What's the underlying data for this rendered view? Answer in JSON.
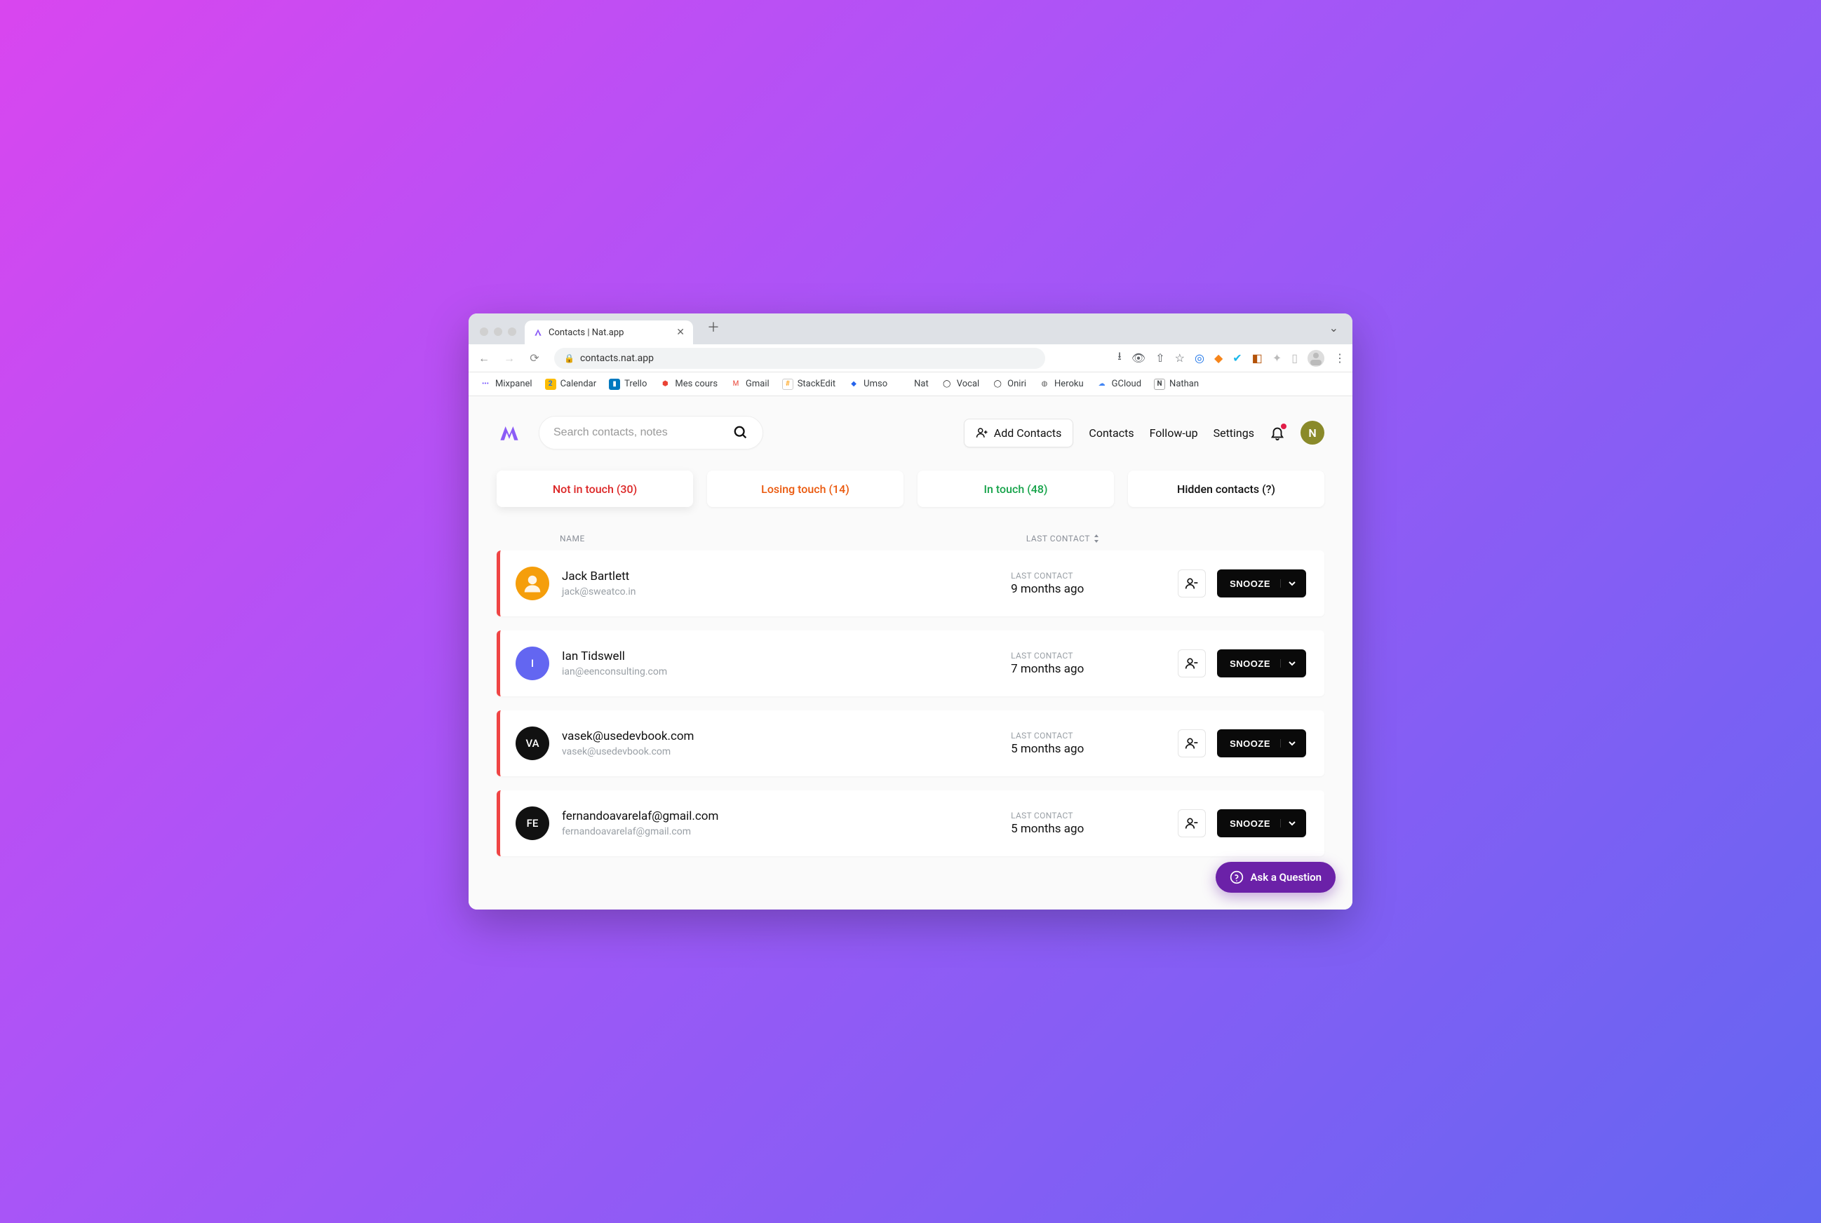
{
  "browser": {
    "tab_title": "Contacts | Nat.app",
    "url": "contacts.nat.app",
    "bookmarks": [
      {
        "label": "Mixpanel"
      },
      {
        "label": "Calendar"
      },
      {
        "label": "Trello"
      },
      {
        "label": "Mes cours"
      },
      {
        "label": "Gmail"
      },
      {
        "label": "StackEdit"
      },
      {
        "label": "Umso"
      },
      {
        "label": "Nat"
      },
      {
        "label": "Vocal"
      },
      {
        "label": "Oniri"
      },
      {
        "label": "Heroku"
      },
      {
        "label": "GCloud"
      },
      {
        "label": "Nathan"
      }
    ]
  },
  "app": {
    "search_placeholder": "Search contacts, notes",
    "add_contacts_label": "Add Contacts",
    "nav": {
      "contacts": "Contacts",
      "followup": "Follow-up",
      "settings": "Settings"
    },
    "user_initial": "N",
    "filters": {
      "not_in_touch": "Not in touch (30)",
      "losing_touch": "Losing touch (14)",
      "in_touch": "In touch (48)",
      "hidden": "Hidden contacts (?)"
    },
    "table": {
      "name_header": "NAME",
      "last_contact_header": "LAST CONTACT",
      "last_contact_label": "LAST CONTACT",
      "snooze_label": "SNOOZE"
    },
    "contacts": [
      {
        "name": "Jack Bartlett",
        "email": "jack@sweatco.in",
        "initials": "",
        "last": "9 months ago",
        "avatar": "orange"
      },
      {
        "name": "Ian Tidswell",
        "email": "ian@eenconsulting.com",
        "initials": "I",
        "last": "7 months ago",
        "avatar": "blue"
      },
      {
        "name": "vasek@usedevbook.com",
        "email": "vasek@usedevbook.com",
        "initials": "VA",
        "last": "5 months ago",
        "avatar": "black"
      },
      {
        "name": "fernandoavarelaf@gmail.com",
        "email": "fernandoavarelaf@gmail.com",
        "initials": "FE",
        "last": "5 months ago",
        "avatar": "black"
      }
    ],
    "help_label": "Ask a Question"
  }
}
